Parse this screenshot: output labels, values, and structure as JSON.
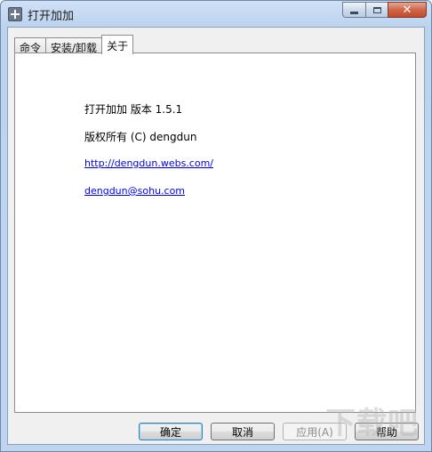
{
  "window": {
    "title": "打开加加",
    "caption": {
      "close": "✕"
    }
  },
  "tabs": [
    {
      "label": "命令"
    },
    {
      "label": "安装/卸载"
    },
    {
      "label": "关于"
    }
  ],
  "about": {
    "version_line": "打开加加 版本 1.5.1",
    "copyright_line": "版权所有 (C) dengdun",
    "website": "http://dengdun.webs.com/",
    "email": "dengdun@sohu.com"
  },
  "buttons": {
    "ok": "确定",
    "cancel": "取消",
    "apply": "应用(A)",
    "help": "帮助"
  },
  "watermark": "下载吧",
  "colors": {
    "link": "#0000ee",
    "close_button": "#c44a2a"
  }
}
